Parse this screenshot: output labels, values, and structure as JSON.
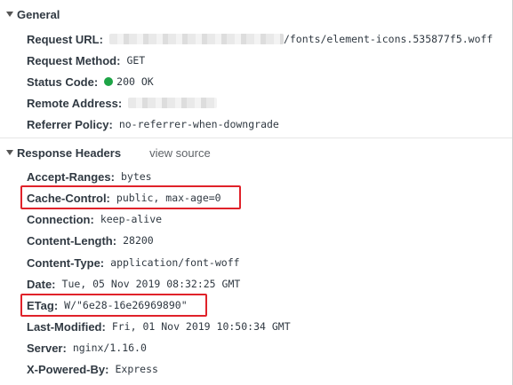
{
  "general": {
    "title": "General",
    "rows": [
      {
        "key": "Request URL:",
        "value": "/fonts/element-icons.535877f5.woff"
      },
      {
        "key": "Request Method:",
        "value": "GET"
      },
      {
        "key": "Status Code:",
        "value": "200 OK"
      },
      {
        "key": "Remote Address:",
        "value": ""
      },
      {
        "key": "Referrer Policy:",
        "value": "no-referrer-when-downgrade"
      }
    ]
  },
  "response_headers": {
    "title": "Response Headers",
    "view_source": "view source",
    "rows": [
      {
        "key": "Accept-Ranges:",
        "value": "bytes"
      },
      {
        "key": "Cache-Control:",
        "value": "public, max-age=0"
      },
      {
        "key": "Connection:",
        "value": "keep-alive"
      },
      {
        "key": "Content-Length:",
        "value": "28200"
      },
      {
        "key": "Content-Type:",
        "value": "application/font-woff"
      },
      {
        "key": "Date:",
        "value": "Tue, 05 Nov 2019 08:32:25 GMT"
      },
      {
        "key": "ETag:",
        "value": "W/\"6e28-16e26969890\""
      },
      {
        "key": "Last-Modified:",
        "value": "Fri, 01 Nov 2019 10:50:34 GMT"
      },
      {
        "key": "Server:",
        "value": "nginx/1.16.0"
      },
      {
        "key": "X-Powered-By:",
        "value": "Express"
      }
    ]
  },
  "colors": {
    "status_ok": "#1ea446",
    "highlight_border": "#e0222a"
  },
  "icons": {
    "expand": "triangle-down-icon",
    "status": "green-status-dot-icon"
  }
}
